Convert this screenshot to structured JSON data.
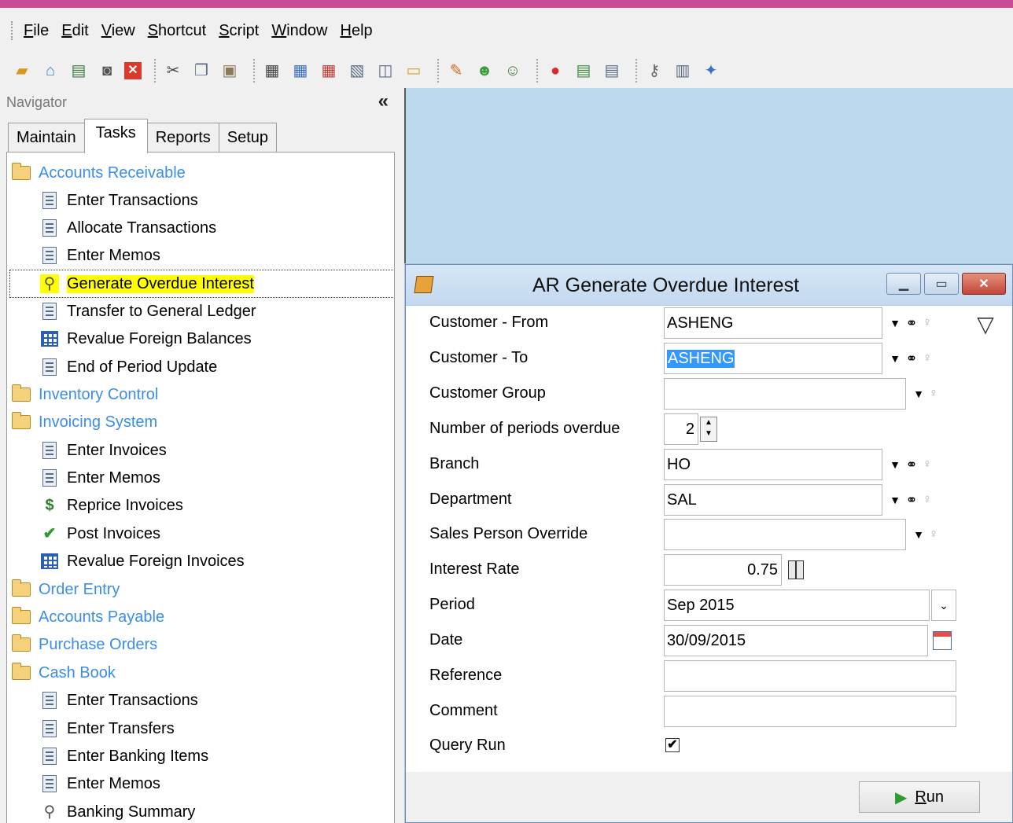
{
  "menu": [
    {
      "label": "File",
      "key": "F",
      "rest": "ile"
    },
    {
      "label": "Edit",
      "key": "E",
      "rest": "dit"
    },
    {
      "label": "View",
      "key": "V",
      "rest": "iew"
    },
    {
      "label": "Shortcut",
      "key": "S",
      "rest": "hortcut"
    },
    {
      "label": "Script",
      "key": "S",
      "pre": "",
      "rest": "cript"
    },
    {
      "label": "Window",
      "key": "W",
      "rest": "indow"
    },
    {
      "label": "Help",
      "key": "H",
      "rest": "elp"
    }
  ],
  "navigator": {
    "title": "Navigator",
    "collapse_glyph": "«"
  },
  "tabs": {
    "maintain": "Maintain",
    "tasks": "Tasks",
    "reports": "Reports",
    "setup": "Setup"
  },
  "tree": {
    "ar": "Accounts Receivable",
    "ar_enter_transactions": "Enter Transactions",
    "ar_allocate_transactions": "Allocate Transactions",
    "ar_enter_memos": "Enter Memos",
    "ar_generate_overdue_interest": "Generate Overdue Interest",
    "ar_transfer_gl": "Transfer to General Ledger",
    "ar_revalue_foreign": "Revalue Foreign Balances",
    "ar_end_of_period": "End of Period Update",
    "inventory": "Inventory Control",
    "invoicing": "Invoicing System",
    "inv_enter_invoices": "Enter Invoices",
    "inv_enter_memos": "Enter Memos",
    "inv_reprice": "Reprice Invoices",
    "inv_post": "Post Invoices",
    "inv_revalue": "Revalue Foreign Invoices",
    "order_entry": "Order Entry",
    "ap": "Accounts Payable",
    "purchase_orders": "Purchase Orders",
    "cash_book": "Cash Book",
    "cb_enter_transactions": "Enter Transactions",
    "cb_enter_transfers": "Enter Transfers",
    "cb_enter_banking": "Enter Banking Items",
    "cb_enter_memos": "Enter Memos",
    "cb_banking_summary": "Banking Summary"
  },
  "dialog": {
    "title": "AR Generate Overdue Interest",
    "labels": {
      "customer_from": "Customer - From",
      "customer_to": "Customer - To",
      "customer_group": "Customer Group",
      "periods_overdue": "Number of periods overdue",
      "branch": "Branch",
      "department": "Department",
      "sales_person": "Sales Person Override",
      "interest_rate": "Interest Rate",
      "period": "Period",
      "date": "Date",
      "reference": "Reference",
      "comment": "Comment",
      "query_run": "Query Run"
    },
    "values": {
      "customer_from": "ASHENG",
      "customer_to": "ASHENG",
      "customer_group": "",
      "periods_overdue": "2",
      "branch": "HO",
      "department": "SAL",
      "sales_person": "",
      "interest_rate": "0.75",
      "period": "Sep 2015",
      "date": "30/09/2015",
      "reference": "",
      "comment": "",
      "query_run_check": "✔"
    },
    "run_key": "R",
    "run_rest": "un"
  },
  "colors": {
    "accent_bar": "#c94d94",
    "folder_text": "#3a8ee6",
    "desktop": "#bcd9ee",
    "highlight": "#ffff00"
  }
}
